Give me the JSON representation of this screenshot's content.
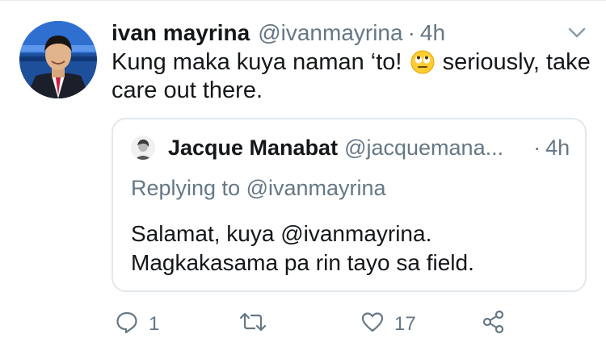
{
  "tweet": {
    "author_name": "ivan mayrina",
    "handle": "@ivanmayrina",
    "separator": "·",
    "time": "4h",
    "text_before": "Kung maka kuya naman ‘to!",
    "emoji": "face-with-rolling-eyes",
    "text_after": "seriously, take care out there."
  },
  "quote": {
    "author_name": "Jacque Manabat",
    "handle": "@jacquemana...",
    "separator": "·",
    "time": "4h",
    "replying_to": "Replying to @ivanmayrina",
    "line1": "Salamat, kuya @ivanmayrina.",
    "line2": "Magkakasama pa rin tayo sa field."
  },
  "actions": {
    "reply_count": "1",
    "retweet_count": "",
    "like_count": "17"
  },
  "colors": {
    "text": "#14171a",
    "muted": "#657786",
    "border": "#e1e8ed"
  }
}
